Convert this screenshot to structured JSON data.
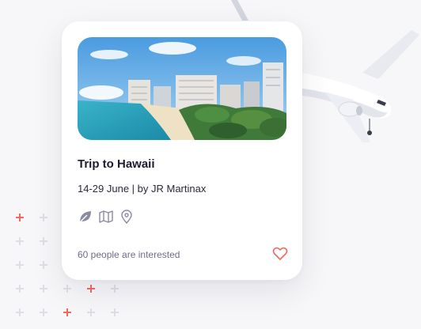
{
  "card": {
    "title": "Trip to Hawaii",
    "subtitle": "14-29 June | by JR Martinax",
    "interested": "60 people are interested",
    "icons": [
      "leaf-icon",
      "map-icon",
      "location-pin-icon"
    ],
    "image": "hawaii-beach-photo"
  },
  "colors": {
    "accent": "#ee6a5e",
    "text": "#1c1c2e",
    "muted": "#6e6e8a",
    "icon": "#8a8aa0"
  }
}
